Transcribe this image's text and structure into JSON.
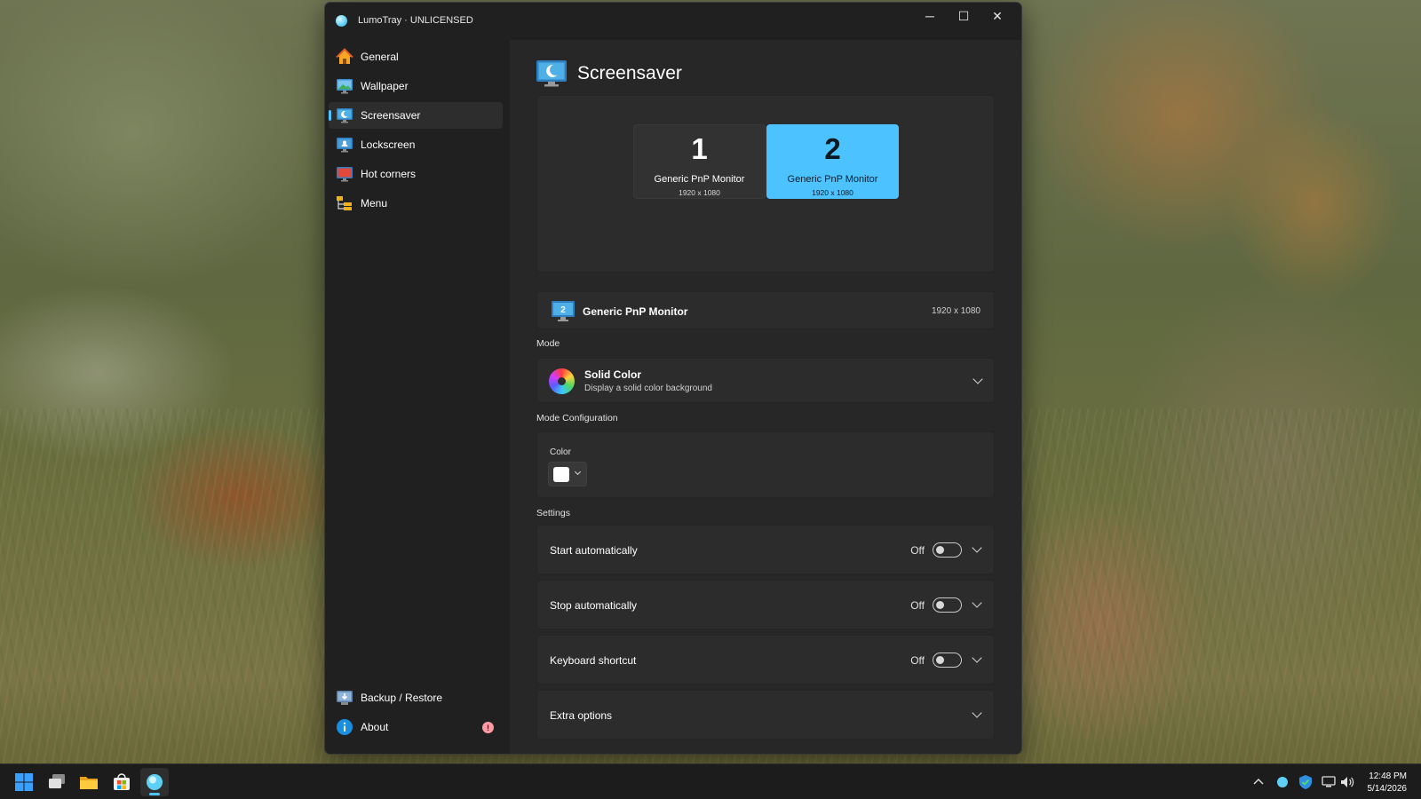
{
  "window": {
    "title": "LumoTray · UNLICENSED",
    "controls": {
      "minimize": "─",
      "maximize": "☐",
      "close": "✕"
    }
  },
  "sidebar": {
    "items": [
      {
        "label": "General",
        "icon": "home-icon"
      },
      {
        "label": "Wallpaper",
        "icon": "wallpaper-icon"
      },
      {
        "label": "Screensaver",
        "icon": "screensaver-icon",
        "active": true
      },
      {
        "label": "Lockscreen",
        "icon": "lockscreen-icon"
      },
      {
        "label": "Hot corners",
        "icon": "hot-corners-icon"
      },
      {
        "label": "Menu",
        "icon": "menu-icon"
      }
    ],
    "footer": [
      {
        "label": "Backup / Restore",
        "icon": "backup-icon"
      },
      {
        "label": "About",
        "icon": "info-icon",
        "badge": "!"
      }
    ]
  },
  "page": {
    "title": "Screensaver",
    "monitors": [
      {
        "number": "1",
        "name": "Generic PnP Monitor",
        "resolution": "1920 x 1080",
        "selected": false
      },
      {
        "number": "2",
        "name": "Generic PnP Monitor",
        "resolution": "1920 x 1080",
        "selected": true
      }
    ],
    "selected_monitor": {
      "number": "2",
      "name": "Generic PnP Monitor",
      "resolution": "1920 x 1080"
    },
    "mode_label": "Mode",
    "mode": {
      "title": "Solid Color",
      "subtitle": "Display a solid color background"
    },
    "mode_config_label": "Mode Configuration",
    "color_label": "Color",
    "color_value": "#ffffff",
    "settings_label": "Settings",
    "settings": [
      {
        "label": "Start automatically",
        "state": "Off",
        "enabled": false
      },
      {
        "label": "Stop automatically",
        "state": "Off",
        "enabled": false
      },
      {
        "label": "Keyboard shortcut",
        "state": "Off",
        "enabled": false
      }
    ],
    "extra_options": "Extra options"
  },
  "taskbar": {
    "apps": [
      "start-icon",
      "task-view-icon",
      "file-explorer-icon",
      "store-icon",
      "lumotray-icon"
    ],
    "tray": [
      "chevron-up-icon",
      "lumotray-tray-icon",
      "security-icon",
      "network-icon",
      "volume-icon"
    ],
    "time": "12:48 PM",
    "date": "5/14/2026"
  },
  "colors": {
    "accent": "#4cc2ff",
    "window_bg": "#202020",
    "content_bg": "#272727",
    "card_bg": "#2c2c2c"
  }
}
